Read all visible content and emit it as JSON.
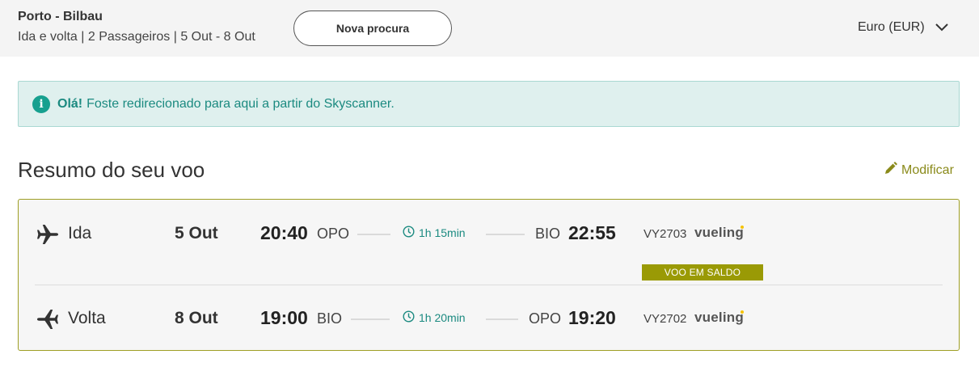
{
  "header": {
    "route": "Porto - Bilbau",
    "summary": "Ida e volta | 2 Passageiros | 5 Out - 8 Out",
    "new_search_label": "Nova procura",
    "currency": "Euro (EUR)"
  },
  "notice": {
    "greeting": "Olá!",
    "message": "Foste redirecionado para aqui a partir do Skyscanner."
  },
  "summary_section": {
    "title": "Resumo do seu voo",
    "modify_label": "Modificar"
  },
  "flights": [
    {
      "label": "Ida",
      "date": "5 Out",
      "dep_time": "20:40",
      "dep_code": "OPO",
      "duration": "1h 15min",
      "arr_code": "BIO",
      "arr_time": "22:55",
      "flight_no": "VY2703",
      "airline": "vueling",
      "badge": "VOO EM SALDO"
    },
    {
      "label": "Volta",
      "date": "8 Out",
      "dep_time": "19:00",
      "dep_code": "BIO",
      "duration": "1h 20min",
      "arr_code": "OPO",
      "arr_time": "19:20",
      "flight_no": "VY2702",
      "airline": "vueling"
    }
  ],
  "colors": {
    "accent": "#9a9a05",
    "teal": "#1b8a80",
    "notice_bg": "#dff0ee"
  },
  "icons": {
    "outbound": "plane-right-icon",
    "return": "plane-left-icon",
    "duration": "clock-icon",
    "modify": "pencil-icon",
    "currency": "chevron-down-icon",
    "notice": "info-icon"
  }
}
